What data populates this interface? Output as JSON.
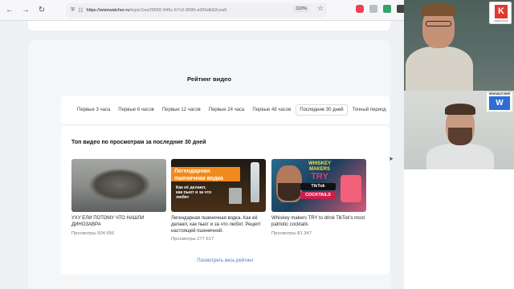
{
  "browser": {
    "url_domain": "https://wisewatcher.ru",
    "url_path": "/topic/1ee26550-945c-67c0-9580-a955db62cea5",
    "zoom": "110%",
    "back_icon": "arrow-left-icon",
    "forward_icon": "arrow-right-icon",
    "reload_icon": "reload-icon",
    "star_icon": "star-icon"
  },
  "panel": {
    "title": "Рейтинг видео",
    "tabs": [
      {
        "label": "Первые 3 часа",
        "active": false
      },
      {
        "label": "Первые 6 часов",
        "active": false
      },
      {
        "label": "Первые 12 часов",
        "active": false
      },
      {
        "label": "Первые 24 часа",
        "active": false
      },
      {
        "label": "Первые 48 часов",
        "active": false
      },
      {
        "label": "Последние 30 дней",
        "active": true
      },
      {
        "label": "Точный период",
        "active": false
      }
    ]
  },
  "videos": {
    "heading": "Топ видео по просмотрам за  последние 30 дней",
    "items": [
      {
        "title": "УХУ ЕЛИ ПОТОМУ ЧТО НАШЛИ ДИНОЗАВРА",
        "views": "Просмотры 504 656"
      },
      {
        "title": "Легендарная пшеничная водка. Как её делают, как пьют и за что любят. Рецепт настоящей пшеничной.",
        "views": "Просмотры 277 617",
        "thumb_banner": "Легендарная",
        "thumb_banner_sub": "пшеничная водка",
        "thumb_sub": "Как её делают, как пьют и за что любят"
      },
      {
        "title": "Whiskey makers TRY to drink TikTok's most patriotic cocktails",
        "views": "Просмотры 81 347",
        "thumb_top": "WHISKEY MAKERS",
        "thumb_try": "TRY",
        "thumb_tiktok": "TikTok",
        "thumb_cocktails": "COCKTAILS"
      }
    ],
    "see_all": "Посмотреть весь рейтинг"
  },
  "overlays": {
    "k_logo_letter": "K",
    "k_logo_caption": "KEEPCALMI",
    "ww_caption": "WISEWATCHER",
    "ww_letter": "W"
  },
  "colors": {
    "accent_link": "#4a78c4",
    "k_logo_red": "#e13a2f",
    "ww_blue": "#2b6fd6"
  }
}
